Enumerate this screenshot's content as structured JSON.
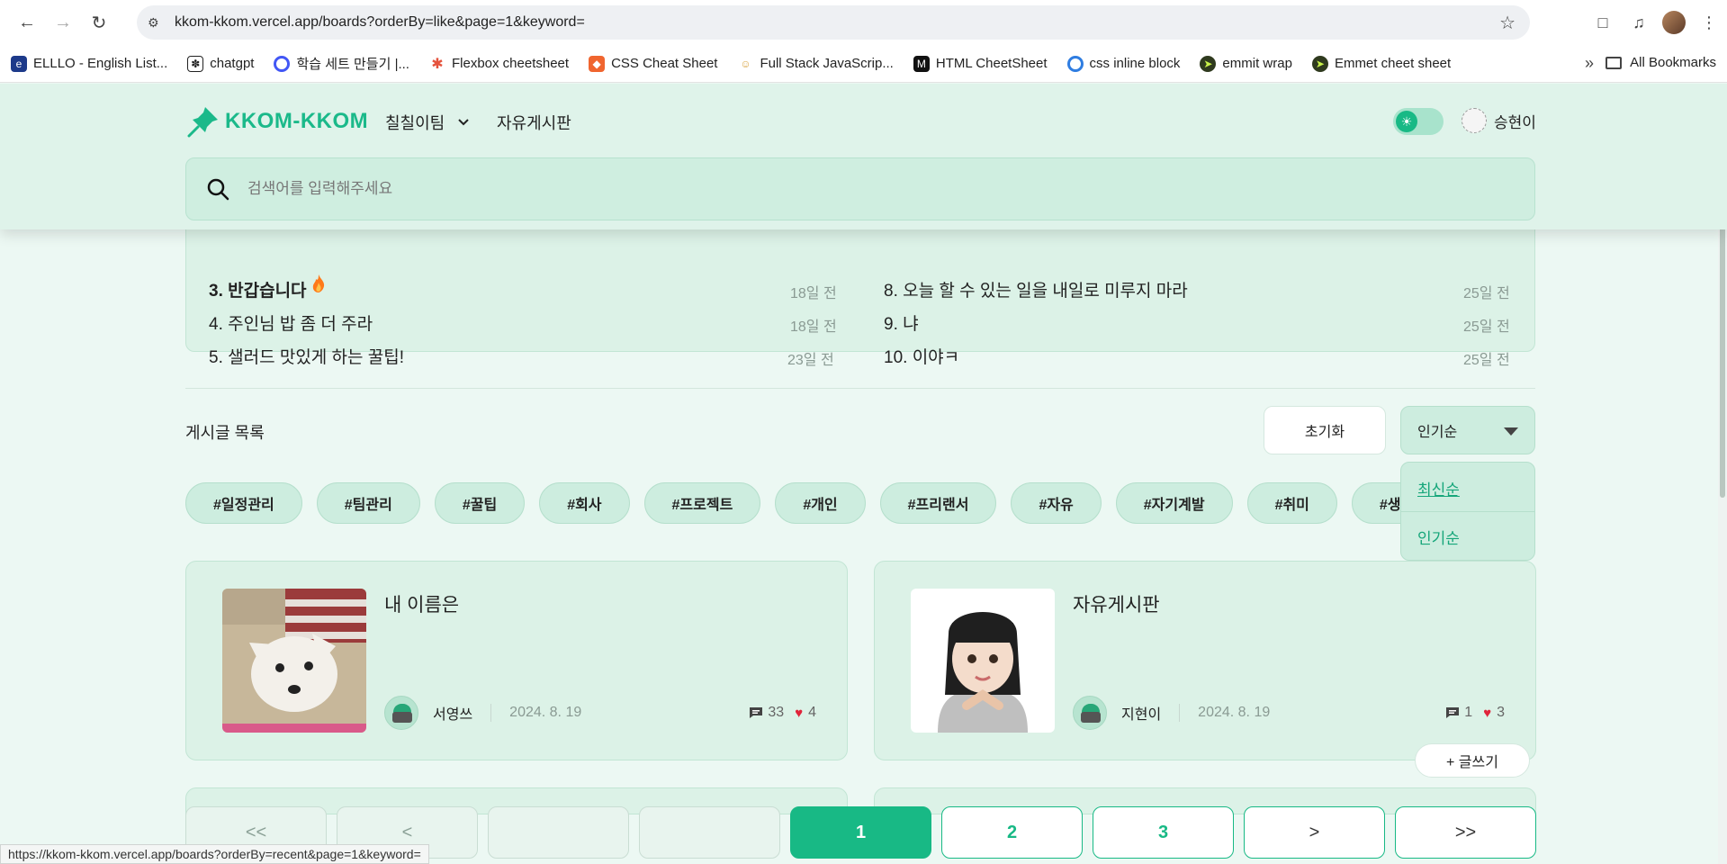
{
  "browser": {
    "url": "kkom-kkom.vercel.app/boards?orderBy=like&page=1&keyword=",
    "bookmarks": [
      {
        "label": "ELLLO - English List...",
        "color": "#1d3a8a"
      },
      {
        "label": "chatgpt",
        "color": "#222222"
      },
      {
        "label": "학습 세트 만들기 |...",
        "color": "#4257f5"
      },
      {
        "label": "Flexbox cheetsheet",
        "color": "#e5533d"
      },
      {
        "label": "CSS Cheat Sheet",
        "color": "#f0652f"
      },
      {
        "label": "Full Stack JavaScrip...",
        "color": "#d9a441"
      },
      {
        "label": "HTML CheetSheet",
        "color": "#111111"
      },
      {
        "label": "css inline block",
        "color": "#2f7de1"
      },
      {
        "label": "emmit wrap",
        "color": "#2f3a1e"
      },
      {
        "label": "Emmet cheet sheet",
        "color": "#2f3a1e"
      }
    ],
    "all_bookmarks": "All Bookmarks",
    "status_url": "https://kkom-kkom.vercel.app/boards?orderBy=recent&page=1&keyword="
  },
  "header": {
    "logo_text": "KKOM-KKOM",
    "team": "칠칠이팀",
    "free_board": "자유게시판",
    "user_name": "승현이",
    "search_placeholder": "검색어를 입력해주세요"
  },
  "popular": {
    "left": [
      {
        "title": "3. 반갑습니다",
        "time": "18일 전",
        "hot": true
      },
      {
        "title": "4. 주인님 밥 좀 더 주라",
        "time": "18일 전"
      },
      {
        "title": "5. 샐러드 맛있게 하는 꿀팁!",
        "time": "23일 전"
      }
    ],
    "right": [
      {
        "title": "8. 오늘 할 수 있는 일을 내일로 미루지 마라",
        "time": "25일 전"
      },
      {
        "title": "9. 냐",
        "time": "25일 전"
      },
      {
        "title": "10. 이야ㅋ",
        "time": "25일 전"
      }
    ]
  },
  "list": {
    "title": "게시글 목록",
    "reset": "초기화",
    "sort_selected": "인기순",
    "sort_options": [
      "최신순",
      "인기순"
    ],
    "tags": [
      "#일정관리",
      "#팀관리",
      "#꿀팁",
      "#회사",
      "#프로젝트",
      "#개인",
      "#프리랜서",
      "#자유",
      "#자기계발",
      "#취미",
      "#생산성"
    ]
  },
  "posts": [
    {
      "title": "내 이름은",
      "author": "서영쓰",
      "date": "2024. 8. 19",
      "comments": "33",
      "likes": "4"
    },
    {
      "title": "자유게시판",
      "author": "지현이",
      "date": "2024. 8. 19",
      "comments": "1",
      "likes": "3"
    }
  ],
  "write_button": "+ 글쓰기",
  "pagination": {
    "first": "<<",
    "prev": "<",
    "pages": [
      "1",
      "2",
      "3"
    ],
    "current": "1",
    "next": ">",
    "last": ">>"
  },
  "colors": {
    "accent": "#18b985",
    "page_bg": "#ecf8f3",
    "card_bg": "#dcf2e7",
    "heart": "#e0243a"
  }
}
